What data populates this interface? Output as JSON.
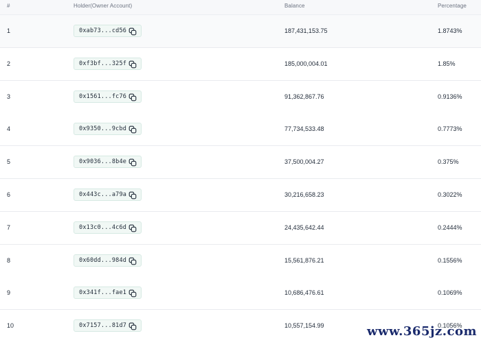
{
  "table": {
    "headers": {
      "rank": "#",
      "holder": "Holder(Owner Account)",
      "balance": "Balance",
      "percentage": "Percentage"
    },
    "rows": [
      {
        "rank": "1",
        "holder": "0xab73...cd56",
        "balance": "187,431,153.75",
        "percentage": "1.8743%"
      },
      {
        "rank": "2",
        "holder": "0xf3bf...325f",
        "balance": "185,000,004.01",
        "percentage": "1.85%"
      },
      {
        "rank": "3",
        "holder": "0x1561...fc76",
        "balance": "91,362,867.76",
        "percentage": "0.9136%"
      },
      {
        "rank": "4",
        "holder": "0x9350...9cbd",
        "balance": "77,734,533.48",
        "percentage": "0.7773%"
      },
      {
        "rank": "5",
        "holder": "0x9036...8b4e",
        "balance": "37,500,004.27",
        "percentage": "0.375%"
      },
      {
        "rank": "6",
        "holder": "0x443c...a79a",
        "balance": "30,216,658.23",
        "percentage": "0.3022%"
      },
      {
        "rank": "7",
        "holder": "0x13c0...4c6d",
        "balance": "24,435,642.44",
        "percentage": "0.2444%"
      },
      {
        "rank": "8",
        "holder": "0x60dd...984d",
        "balance": "15,561,876.21",
        "percentage": "0.1556%"
      },
      {
        "rank": "9",
        "holder": "0x341f...fae1",
        "balance": "10,686,476.61",
        "percentage": "0.1069%"
      },
      {
        "rank": "10",
        "holder": "0x7157...81d7",
        "balance": "10,557,154.99",
        "percentage": "0.1056%"
      }
    ],
    "copy_icon": "copy-icon"
  },
  "watermark": {
    "text": "www.365jz.com"
  }
}
